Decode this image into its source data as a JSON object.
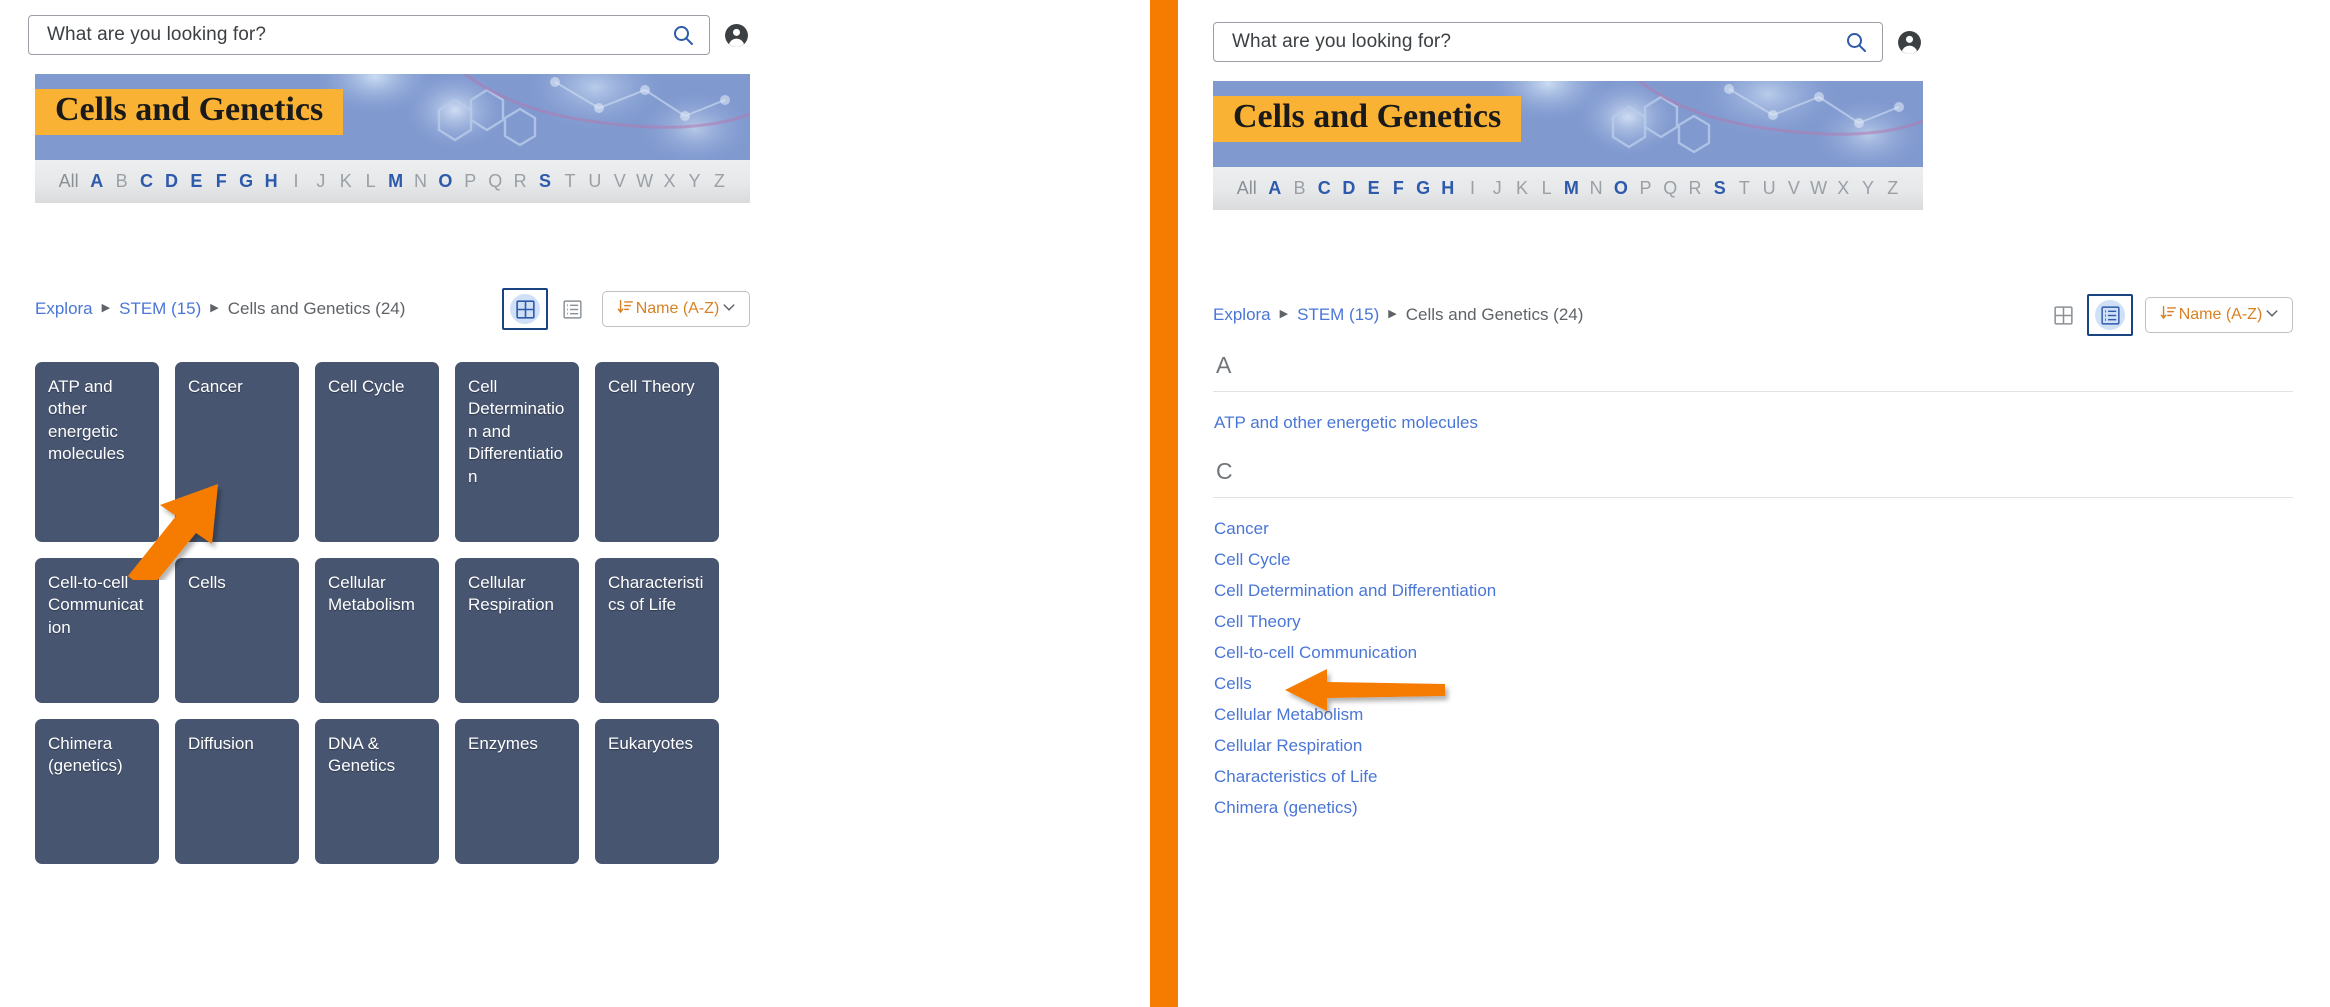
{
  "colors": {
    "accent_orange": "#f57c00",
    "tile_bg": "#475571",
    "link_blue": "#4a76d6",
    "banner_yellow": "#f9b233",
    "selected_border": "#1a4480",
    "selected_pill": "#cfe0f7",
    "sort_text": "#d98024"
  },
  "search": {
    "placeholder": "What are you looking for?",
    "search_icon": "search-icon",
    "account_icon": "account-circle-icon"
  },
  "banner": {
    "title": "Cells and Genetics"
  },
  "alphabet": {
    "all_label": "All",
    "letters": [
      {
        "label": "A",
        "active": true
      },
      {
        "label": "B",
        "active": false
      },
      {
        "label": "C",
        "active": true
      },
      {
        "label": "D",
        "active": true
      },
      {
        "label": "E",
        "active": true
      },
      {
        "label": "F",
        "active": true
      },
      {
        "label": "G",
        "active": true
      },
      {
        "label": "H",
        "active": true
      },
      {
        "label": "I",
        "active": false
      },
      {
        "label": "J",
        "active": false
      },
      {
        "label": "K",
        "active": false
      },
      {
        "label": "L",
        "active": false
      },
      {
        "label": "M",
        "active": true
      },
      {
        "label": "N",
        "active": false
      },
      {
        "label": "O",
        "active": true
      },
      {
        "label": "P",
        "active": false
      },
      {
        "label": "Q",
        "active": false
      },
      {
        "label": "R",
        "active": false
      },
      {
        "label": "S",
        "active": true
      },
      {
        "label": "T",
        "active": false
      },
      {
        "label": "U",
        "active": false
      },
      {
        "label": "V",
        "active": false
      },
      {
        "label": "W",
        "active": false
      },
      {
        "label": "X",
        "active": false
      },
      {
        "label": "Y",
        "active": false
      },
      {
        "label": "Z",
        "active": false
      }
    ]
  },
  "breadcrumb": {
    "root": "Explora",
    "parent": "STEM (15)",
    "current": "Cells and Genetics (24)",
    "separator": "▶"
  },
  "toolbar": {
    "grid_view_label": "grid-view",
    "list_view_label": "list-view",
    "sort_label": "Name (A-Z)",
    "sort_icon": "sort-descending-icon",
    "caret_icon": "chevron-down-icon"
  },
  "left_panel": {
    "selected_view": "grid",
    "tiles": [
      "ATP and other energetic molecules",
      "Cancer",
      "Cell Cycle",
      "Cell Determination and Differentiation",
      "Cell Theory",
      "Cell-to-cell Communication",
      "Cells",
      "Cellular Metabolism",
      "Cellular Respiration",
      "Characteristics of Life",
      "Chimera (genetics)",
      "Diffusion",
      "DNA & Genetics",
      "Enzymes",
      "Eukaryotes"
    ]
  },
  "right_panel": {
    "selected_view": "list",
    "groups": [
      {
        "letter": "A",
        "items": [
          "ATP and other energetic molecules"
        ]
      },
      {
        "letter": "C",
        "items": [
          "Cancer",
          "Cell Cycle",
          "Cell Determination and Differentiation",
          "Cell Theory",
          "Cell-to-cell Communication",
          "Cells",
          "Cellular Metabolism",
          "Cellular Respiration",
          "Characteristics of Life",
          "Chimera (genetics)"
        ]
      }
    ]
  },
  "annotations": {
    "left_arrow_target": "Cells",
    "right_arrow_target": "Cells",
    "arrow_color": "#f57c00"
  }
}
